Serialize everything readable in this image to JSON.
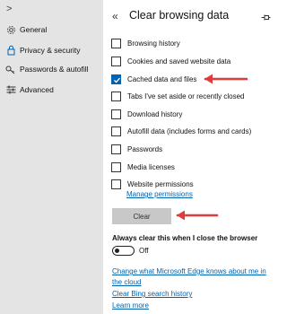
{
  "sidebar": {
    "items": [
      {
        "label": "General",
        "icon": "gear-icon"
      },
      {
        "label": "Privacy & security",
        "icon": "lock-icon",
        "selected": true
      },
      {
        "label": "Passwords & autofill",
        "icon": "key-icon"
      },
      {
        "label": "Advanced",
        "icon": "sliders-icon"
      }
    ]
  },
  "panel": {
    "title": "Clear browsing data",
    "options": [
      {
        "label": "Browsing history",
        "checked": false
      },
      {
        "label": "Cookies and saved website data",
        "checked": false
      },
      {
        "label": "Cached data and files",
        "checked": true
      },
      {
        "label": "Tabs I've set aside or recently closed",
        "checked": false
      },
      {
        "label": "Download history",
        "checked": false
      },
      {
        "label": "Autofill data (includes forms and cards)",
        "checked": false
      },
      {
        "label": "Passwords",
        "checked": false
      },
      {
        "label": "Media licenses",
        "checked": false
      },
      {
        "label": "Website permissions",
        "checked": false
      }
    ],
    "manage_permissions_link": "Manage permissions",
    "clear_button": "Clear",
    "always_clear_label": "Always clear this when I close the browser",
    "toggle_state": "Off",
    "links": {
      "change_data_line1": "Change what Microsoft Edge knows about me in",
      "change_data_line2": "the cloud",
      "clear_bing": "Clear Bing search history",
      "learn_more": "Learn more"
    }
  },
  "colors": {
    "accent": "#0063b1",
    "sidebar_bg": "#e4e4e4",
    "annotation_arrow": "#e03a3a",
    "button_bg": "#c8c8c8"
  }
}
